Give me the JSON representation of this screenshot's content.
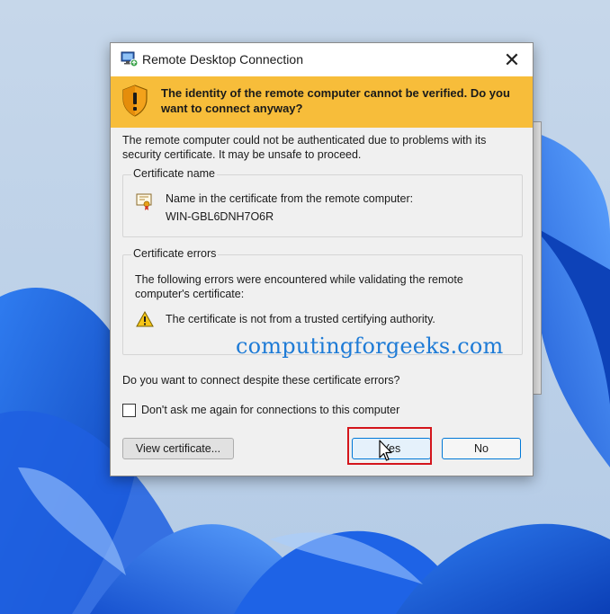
{
  "window": {
    "title": "Remote Desktop Connection",
    "close_glyph": "✕"
  },
  "banner": {
    "message": "The identity of the remote computer cannot be verified. Do you want to connect anyway?",
    "color": "#f7bd3a"
  },
  "intro": "The remote computer could not be authenticated due to problems with its security certificate. It may be unsafe to proceed.",
  "certificate_name": {
    "title": "Certificate name",
    "label": "Name in the certificate from the remote computer:",
    "value": "WIN-GBL6DNH7O6R"
  },
  "certificate_errors": {
    "title": "Certificate errors",
    "intro": "The following errors were encountered while validating the remote computer's certificate:",
    "items": [
      "The certificate is not from a trusted certifying authority."
    ]
  },
  "question": "Do you want to connect despite these certificate errors?",
  "checkbox": {
    "label": "Don't ask me again for connections to this computer",
    "checked": false
  },
  "buttons": {
    "view_certificate": "View certificate...",
    "yes": "Yes",
    "no": "No"
  },
  "watermark": "computingforgeeks.com",
  "icons": {
    "app": "remote-desktop-icon",
    "banner": "shield-warning-icon",
    "certificate": "certificate-icon",
    "error": "warning-triangle-icon"
  },
  "colors": {
    "highlight": "#d4151b",
    "watermark": "#1e7bd6",
    "accent": "#0078d7"
  }
}
